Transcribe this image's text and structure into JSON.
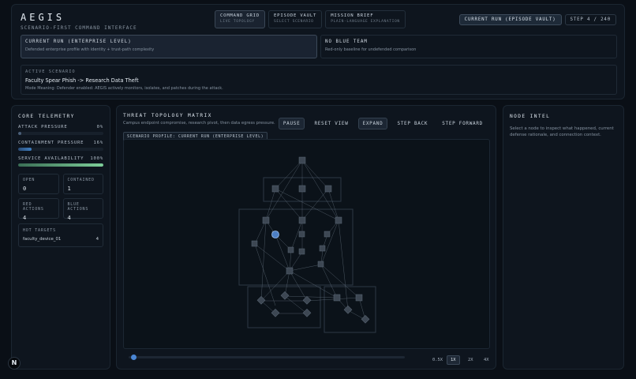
{
  "app": {
    "title": "AEGIS",
    "subtitle": "SCENARIO-FIRST COMMAND INTERFACE"
  },
  "nav": {
    "tabs": [
      {
        "label": "COMMAND GRID",
        "sub": "LIVE TOPOLOGY",
        "active": true
      },
      {
        "label": "EPISODE VAULT",
        "sub": "SELECT SCENARIO",
        "active": false
      },
      {
        "label": "MISSION BRIEF",
        "sub": "PLAIN-LANGUAGE EXPLANATION",
        "active": false
      }
    ]
  },
  "status": {
    "run": "CURRENT RUN (EPISODE VAULT)",
    "step": "STEP 4 / 240"
  },
  "modes": [
    {
      "title": "CURRENT RUN (ENTERPRISE LEVEL)",
      "desc": "Defended enterprise profile with identity + trust-path complexity",
      "active": true
    },
    {
      "title": "NO BLUE TEAM",
      "desc": "Red-only baseline for undefended comparison",
      "active": false
    }
  ],
  "scenario": {
    "label": "ACTIVE SCENARIO",
    "name": "Faculty Spear Phish -> Research Data Theft",
    "meaning": "Mode Meaning: Defender enabled: AEGIS actively monitors, isolates, and patches during the attack."
  },
  "telemetry": {
    "title": "CORE TELEMETRY",
    "metrics": [
      {
        "label": "ATTACK PRESSURE",
        "value": "0%",
        "fraction": 0.0,
        "color": "#4a5f78"
      },
      {
        "label": "CONTAINMENT PRESSURE",
        "value": "16%",
        "fraction": 0.16,
        "color": "#3f7fc0"
      },
      {
        "label": "SERVICE AVAILABILITY",
        "value": "100%",
        "fraction": 1.0,
        "color": "#7ecf9a"
      }
    ],
    "stats": [
      {
        "label": "OPEN",
        "value": "0"
      },
      {
        "label": "CONTAINED",
        "value": "1"
      },
      {
        "label": "RED ACTIONS",
        "value": "4"
      },
      {
        "label": "BLUE ACTIONS",
        "value": "4"
      }
    ],
    "hot_targets": {
      "label": "HOT TARGETS",
      "items": [
        {
          "name": "faculty_device_01",
          "count": "4"
        }
      ]
    }
  },
  "topology": {
    "title": "THREAT TOPOLOGY MATRIX",
    "desc": "Campus endpoint compromise, research pivot, then data egress pressure.",
    "profile": "SCENARIO PROFILE: CURRENT RUN (ENTERPRISE LEVEL)",
    "controls": [
      {
        "label": "PAUSE",
        "boxed": true
      },
      {
        "label": "RESET VIEW",
        "boxed": false
      },
      {
        "label": "EXPAND",
        "boxed": true
      },
      {
        "label": "STEP BACK",
        "boxed": false
      },
      {
        "label": "STEP FORWARD",
        "boxed": false
      }
    ],
    "zoom": [
      {
        "label": "0.5X",
        "active": false
      },
      {
        "label": "1X",
        "active": true
      },
      {
        "label": "2X",
        "active": false
      },
      {
        "label": "4X",
        "active": false
      }
    ],
    "timeline_progress": 0.017
  },
  "node_intel": {
    "title": "NODE INTEL",
    "desc": "Select a node to inspect what happened, current defense rationale, and connection context."
  },
  "footer": {
    "logo": "N"
  }
}
